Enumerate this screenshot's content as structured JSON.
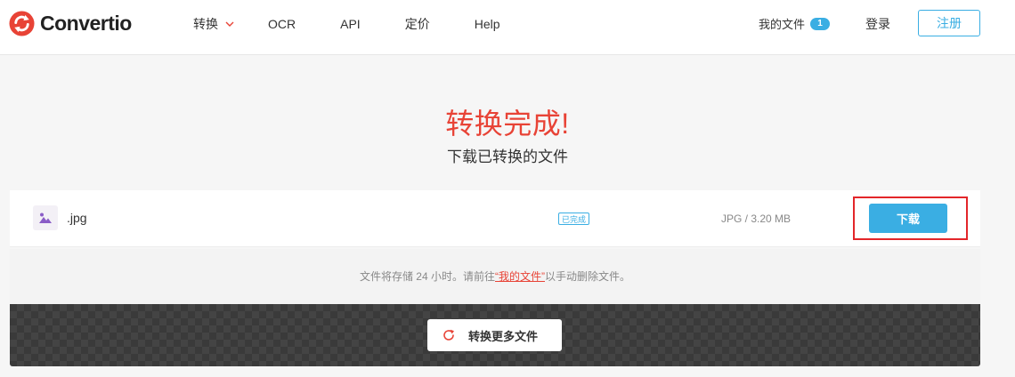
{
  "header": {
    "logo_text": "Convertio",
    "nav": [
      {
        "label": "转换"
      },
      {
        "label": "OCR"
      },
      {
        "label": "API"
      },
      {
        "label": "定价"
      },
      {
        "label": "Help"
      }
    ],
    "my_files_label": "我的文件",
    "my_files_count": "1",
    "login_label": "登录",
    "register_label": "注册"
  },
  "hero": {
    "title": "转换完成!",
    "subtitle": "下载已转换的文件"
  },
  "file": {
    "name": ".jpg",
    "status": "已完成",
    "meta": "JPG / 3.20 MB",
    "download_label": "下载"
  },
  "notice": {
    "prefix": "文件将存储 24 小时。请前往",
    "link": "“我的文件”",
    "suffix": "以手动删除文件。"
  },
  "more": {
    "label": "转换更多文件"
  },
  "colors": {
    "accent": "#3aaee3",
    "brand_red": "#e84336",
    "highlight_frame": "#e3262a"
  }
}
